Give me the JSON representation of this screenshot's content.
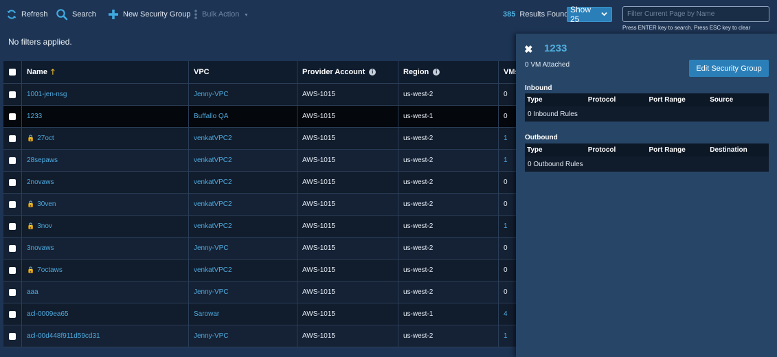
{
  "toolbar": {
    "refresh_label": "Refresh",
    "search_label": "Search",
    "new_group_label": "New Security Group",
    "bulk_action_label": "Bulk Action",
    "results_count": "385",
    "results_label": "Results Found",
    "show_label": "Show 25",
    "search_placeholder": "Filter Current Page by Name",
    "search_value": "",
    "search_hint": "Press ENTER key to search. Press ESC key to clear"
  },
  "filters_text": "No filters applied.",
  "table": {
    "columns": {
      "name": "Name",
      "vpc": "VPC",
      "account": "Provider Account",
      "region": "Region",
      "vms": "VMs"
    },
    "rows": [
      {
        "name": "1001-jen-nsg",
        "vpc": "Jenny-VPC",
        "account": "AWS-1015",
        "region": "us-west-2",
        "vms": "0",
        "locked": false,
        "vms_link": false
      },
      {
        "name": "1233",
        "vpc": "Buffallo QA",
        "account": "AWS-1015",
        "region": "us-west-1",
        "vms": "0",
        "locked": false,
        "vms_link": false
      },
      {
        "name": "27oct",
        "vpc": "venkatVPC2",
        "account": "AWS-1015",
        "region": "us-west-2",
        "vms": "1",
        "locked": true,
        "vms_link": true
      },
      {
        "name": "28sepaws",
        "vpc": "venkatVPC2",
        "account": "AWS-1015",
        "region": "us-west-2",
        "vms": "1",
        "locked": false,
        "vms_link": true
      },
      {
        "name": "2novaws",
        "vpc": "venkatVPC2",
        "account": "AWS-1015",
        "region": "us-west-2",
        "vms": "0",
        "locked": false,
        "vms_link": false
      },
      {
        "name": "30ven",
        "vpc": "venkatVPC2",
        "account": "AWS-1015",
        "region": "us-west-2",
        "vms": "0",
        "locked": true,
        "vms_link": false
      },
      {
        "name": "3nov",
        "vpc": "venkatVPC2",
        "account": "AWS-1015",
        "region": "us-west-2",
        "vms": "1",
        "locked": true,
        "vms_link": true
      },
      {
        "name": "3novaws",
        "vpc": "Jenny-VPC",
        "account": "AWS-1015",
        "region": "us-west-2",
        "vms": "0",
        "locked": false,
        "vms_link": false
      },
      {
        "name": "7octaws",
        "vpc": "venkatVPC2",
        "account": "AWS-1015",
        "region": "us-west-2",
        "vms": "0",
        "locked": true,
        "vms_link": false
      },
      {
        "name": "aaa",
        "vpc": "Jenny-VPC",
        "account": "AWS-1015",
        "region": "us-west-2",
        "vms": "0",
        "locked": false,
        "vms_link": false
      },
      {
        "name": "acl-0009ea65",
        "vpc": "Sarowar",
        "account": "AWS-1015",
        "region": "us-west-1",
        "vms": "4",
        "locked": false,
        "vms_link": true
      },
      {
        "name": "acl-00d448f911d59cd31",
        "vpc": "Jenny-VPC",
        "account": "AWS-1015",
        "region": "us-west-2",
        "vms": "1",
        "locked": false,
        "vms_link": true
      }
    ]
  },
  "panel": {
    "title": "1233",
    "vm_attached": "0 VM Attached",
    "edit_label": "Edit Security Group",
    "inbound_title": "Inbound",
    "inbound_columns": [
      "Type",
      "Protocol",
      "Port Range",
      "Source"
    ],
    "inbound_empty": "0 Inbound Rules",
    "outbound_title": "Outbound",
    "outbound_columns": [
      "Type",
      "Protocol",
      "Port Range",
      "Destination"
    ],
    "outbound_empty": "0 Outbound Rules"
  },
  "colors": {
    "background": "#1d3454",
    "accent": "#2b7fb8",
    "link": "#4ea9dc",
    "lock": "#e8b830"
  }
}
